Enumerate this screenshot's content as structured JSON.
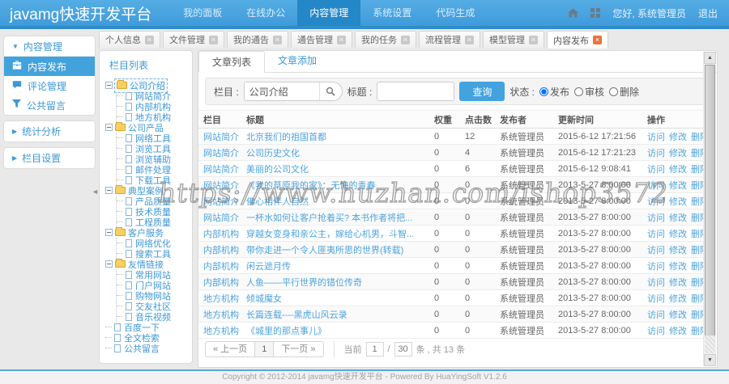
{
  "navbar": {
    "logo": "javamg快速开发平台",
    "menu": [
      "我的面板",
      "在线办公",
      "内容管理",
      "系统设置",
      "代码生成"
    ],
    "active_menu": "内容管理",
    "greeting": "您好, 系统管理员",
    "logout": "退出"
  },
  "workspace_tabs": {
    "items": [
      "个人信息",
      "文件管理",
      "我的通告",
      "通告管理",
      "我的任务",
      "流程管理",
      "模型管理",
      "内容发布"
    ],
    "active": "内容发布"
  },
  "sidebar": {
    "panels": [
      {
        "title": "内容管理",
        "expanded": true,
        "items": [
          {
            "label": "内容发布",
            "icon": "briefcase-icon",
            "active": true
          },
          {
            "label": "评论管理",
            "icon": "comment-icon",
            "active": false
          },
          {
            "label": "公共留言",
            "icon": "funnel-icon",
            "active": false
          }
        ]
      },
      {
        "title": "统计分析",
        "expanded": false,
        "items": []
      },
      {
        "title": "栏目设置",
        "expanded": false,
        "items": []
      }
    ]
  },
  "tree": {
    "title": "栏目列表",
    "nodes": [
      {
        "label": "公司介绍",
        "type": "folder",
        "selected": true,
        "children": [
          "网站简介",
          "内部机构",
          "地方机构"
        ]
      },
      {
        "label": "公司产品",
        "type": "folder",
        "selected": false,
        "children": [
          "网络工具",
          "浏览工具",
          "浏览辅助",
          "邮件处理",
          "下载工具"
        ]
      },
      {
        "label": "典型案例",
        "type": "folder",
        "selected": false,
        "children": [
          "产品质量",
          "技术质量",
          "工程质量"
        ]
      },
      {
        "label": "客户服务",
        "type": "folder",
        "selected": false,
        "children": [
          "网络优化",
          "搜索工具"
        ]
      },
      {
        "label": "友情链接",
        "type": "folder",
        "selected": false,
        "children": [
          "常用网站",
          "门户网站",
          "购物网站",
          "交友社区",
          "音乐视频"
        ]
      },
      {
        "label": "百度一下",
        "type": "file",
        "selected": false,
        "children": []
      },
      {
        "label": "全文检索",
        "type": "file",
        "selected": false,
        "children": []
      },
      {
        "label": "公共留言",
        "type": "file",
        "selected": false,
        "children": []
      }
    ]
  },
  "content": {
    "tabs": [
      {
        "label": "文章列表",
        "active": true
      },
      {
        "label": "文章添加",
        "active": false
      }
    ],
    "filter": {
      "category_label": "栏目 :",
      "category_value": "公司介绍",
      "title_label": "标题 :",
      "title_value": "",
      "search_button": "查询",
      "status_label": "状态 :",
      "status_options": [
        {
          "label": "发布",
          "checked": true
        },
        {
          "label": "审核",
          "checked": false
        },
        {
          "label": "删除",
          "checked": false
        }
      ]
    },
    "table": {
      "columns": [
        "栏目",
        "标题",
        "权重",
        "点击数",
        "发布者",
        "更新时间",
        "操作"
      ],
      "actions": [
        "访问",
        "修改",
        "删除"
      ],
      "rows": [
        {
          "category": "网站简介",
          "title": "北京我们的祖国首都",
          "weight": "0",
          "clicks": "12",
          "publisher": "系统管理员",
          "updated": "2015-6-12 17:21:56"
        },
        {
          "category": "网站简介",
          "title": "公司历史文化",
          "weight": "0",
          "clicks": "4",
          "publisher": "系统管理员",
          "updated": "2015-6-12 17:21:23"
        },
        {
          "category": "网站简介",
          "title": "美丽的公司文化",
          "weight": "0",
          "clicks": "6",
          "publisher": "系统管理员",
          "updated": "2015-6-12 9:08:41"
        },
        {
          "category": "网站简介",
          "title": "《我的草原我的家》：无悔的青春",
          "weight": "0",
          "clicks": "0",
          "publisher": "系统管理员",
          "updated": "2013-5-27 8:00:00"
        },
        {
          "category": "网站简介",
          "title": "佛心相伴人自然",
          "weight": "0",
          "clicks": "0",
          "publisher": "系统管理员",
          "updated": "2013-5-27 8:00:00"
        },
        {
          "category": "网站简介",
          "title": "一杯水如何让客户抢着买? 本书作者将把...",
          "weight": "0",
          "clicks": "0",
          "publisher": "系统管理员",
          "updated": "2013-5-27 8:00:00"
        },
        {
          "category": "内部机构",
          "title": "穿越女变身和亲公主，嫁给心机男，斗智...",
          "weight": "0",
          "clicks": "0",
          "publisher": "系统管理员",
          "updated": "2013-5-27 8:00:00"
        },
        {
          "category": "内部机构",
          "title": "带你走进一个令人匪夷所思的世界(转载)",
          "weight": "0",
          "clicks": "0",
          "publisher": "系统管理员",
          "updated": "2013-5-27 8:00:00"
        },
        {
          "category": "内部机构",
          "title": "闲云遮月传",
          "weight": "0",
          "clicks": "0",
          "publisher": "系统管理员",
          "updated": "2013-5-27 8:00:00"
        },
        {
          "category": "内部机构",
          "title": "人鱼——平行世界的错位传奇",
          "weight": "0",
          "clicks": "0",
          "publisher": "系统管理员",
          "updated": "2013-5-27 8:00:00"
        },
        {
          "category": "地方机构",
          "title": "倾城魔女",
          "weight": "0",
          "clicks": "0",
          "publisher": "系统管理员",
          "updated": "2013-5-27 8:00:00"
        },
        {
          "category": "地方机构",
          "title": "长篇连载----黑虎山风云录",
          "weight": "0",
          "clicks": "0",
          "publisher": "系统管理员",
          "updated": "2013-5-27 8:00:00"
        },
        {
          "category": "地方机构",
          "title": "《城里的那点事儿》",
          "weight": "0",
          "clicks": "0",
          "publisher": "系统管理员",
          "updated": "2013-5-27 8:00:00"
        }
      ]
    },
    "pagination": {
      "prev": "« 上一页",
      "page": "1",
      "next": "下一页 »",
      "current_label": "当前",
      "current_value": "1",
      "slash": "/",
      "size_value": "30",
      "suffix": "条 , 共 13 条"
    }
  },
  "watermark": "https://www.huzhan.com/ishop3572",
  "footer": "Copyright © 2012-2014 javamg快速开发平台 - Powered By HuaYingSoft V1.2.6",
  "colors": {
    "navbar": "#4BA4E0",
    "navbar_active": "#2387C8",
    "accent": "#3E97D6",
    "link": "#4DA3DF",
    "query_button": "#42A3DF",
    "sidebar_active": "#42A3DC",
    "folder": "#F2C245",
    "active_tab_close": "#E8743B"
  }
}
